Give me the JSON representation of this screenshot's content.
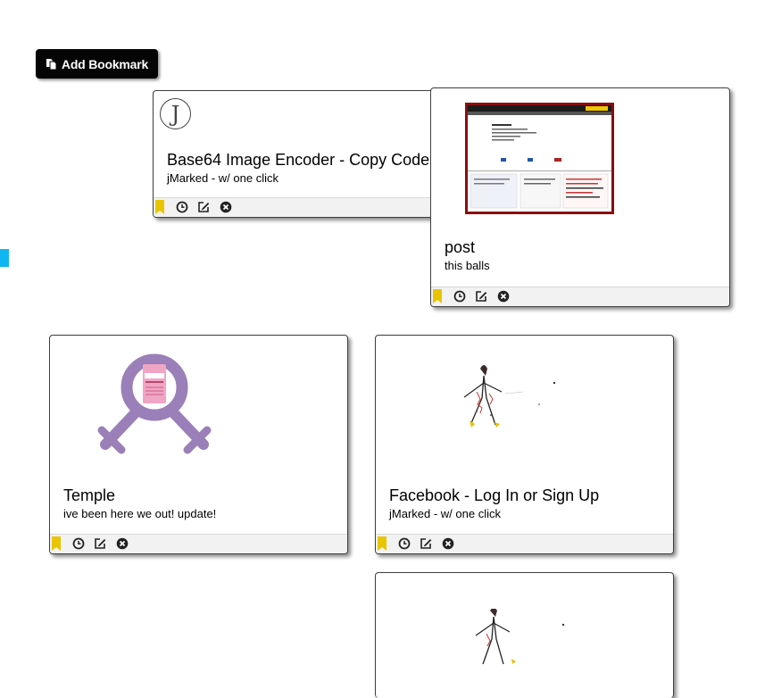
{
  "add_bookmark": {
    "label": "Add Bookmark",
    "icon": "copy-icon"
  },
  "colors": {
    "bookmark_flag": "#e9c400",
    "toolbar_bg": "#f2f2f2",
    "edge_marker": "#10b6f2"
  },
  "cards": [
    {
      "title": "Base64 Image Encoder - Copy Code",
      "description": "jMarked - w/ one click",
      "thumbnail": "j-logo-icon"
    },
    {
      "title": "post",
      "description": "this balls",
      "thumbnail": "webpage-screenshot-thumbnail"
    },
    {
      "title": "Temple",
      "description": "ive been here we out! update!",
      "thumbnail": "purple-venus-symbol-thumbnail"
    },
    {
      "title": "Facebook - Log In or Sign Up",
      "description": "jMarked - w/ one click",
      "thumbnail": "sketch-figure-thumbnail"
    },
    {
      "title": "",
      "description": "",
      "thumbnail": "sketch-figure-thumbnail"
    }
  ],
  "toolbar_icons": [
    "bookmark-flag-icon",
    "clock-icon",
    "edit-icon",
    "delete-icon"
  ],
  "j_logo_letter": "J"
}
